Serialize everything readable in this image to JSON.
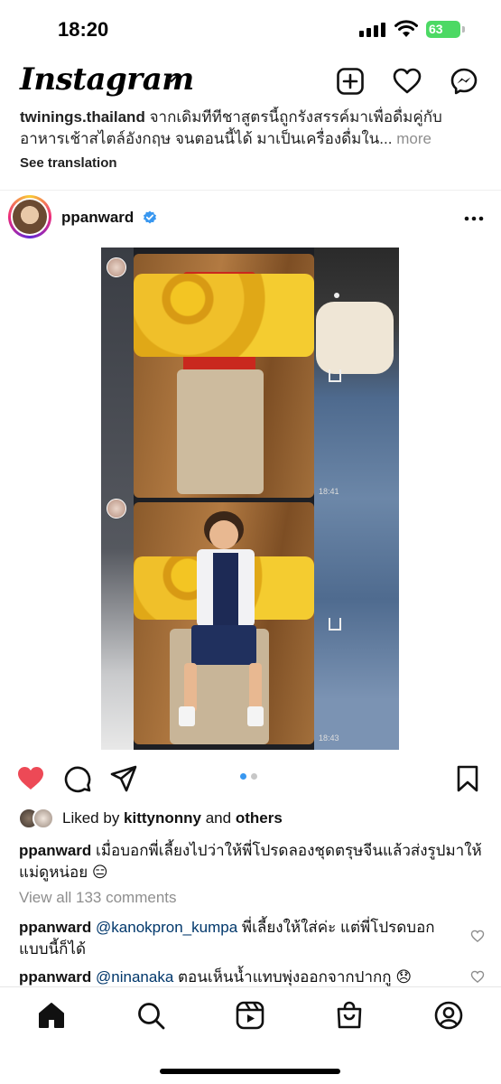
{
  "status_bar": {
    "time": "18:20",
    "battery": "63"
  },
  "header": {
    "logo": "Instagram",
    "icons": [
      "new-post-icon",
      "heart-icon",
      "messenger-icon"
    ]
  },
  "previous_post": {
    "username": "twinings.thailand",
    "caption_line1": " จากเดิมทีทีชาสูตรนี้ถูกรังสรรค์มาเพื่อดื่มคู่กับ",
    "caption_line2": "อาหารเช้าสไตล์อังกฤษ จนตอนนี้ได้ มาเป็นเครื่องดื่มใน...",
    "more": "more",
    "see_translation": "See translation"
  },
  "post": {
    "username": "ppanward",
    "verified": true,
    "carousel": {
      "count": 2,
      "active": 0
    },
    "media_time_labels": [
      "18:41",
      "18:43"
    ],
    "liked_by_prefix": "Liked by ",
    "liked_by_user": "kittynonny",
    "liked_by_and": " and ",
    "liked_by_others": "others",
    "caption_user": "ppanward",
    "caption_text": " เมื่อบอกพี่เลี้ยงไปว่าให้พี่โปรดลองชุดตรุษจีนแล้วส่งรูปมาให้แม่ดูหน่อย 😑",
    "view_comments": "View all 133 comments",
    "comments": [
      {
        "user": "ppanward",
        "mention": "@kanokpron_kumpa",
        "text": " พี่เลี้ยงให้ใส่ค่ะ แต่พี่โปรดบอกแบบนี้ก็ได้"
      },
      {
        "user": "ppanward",
        "mention": "@ninanaka",
        "text": " ตอนเห็นน้ำแทบพุ่งออกจากปากกู 😞"
      }
    ]
  },
  "bottom_nav": [
    "home-icon",
    "search-icon",
    "reels-icon",
    "shop-icon",
    "profile-icon"
  ],
  "colors": {
    "like_red": "#ed4956",
    "carousel_active": "#3897f0",
    "mention_blue": "#00376b",
    "verified_blue": "#3897f0"
  }
}
